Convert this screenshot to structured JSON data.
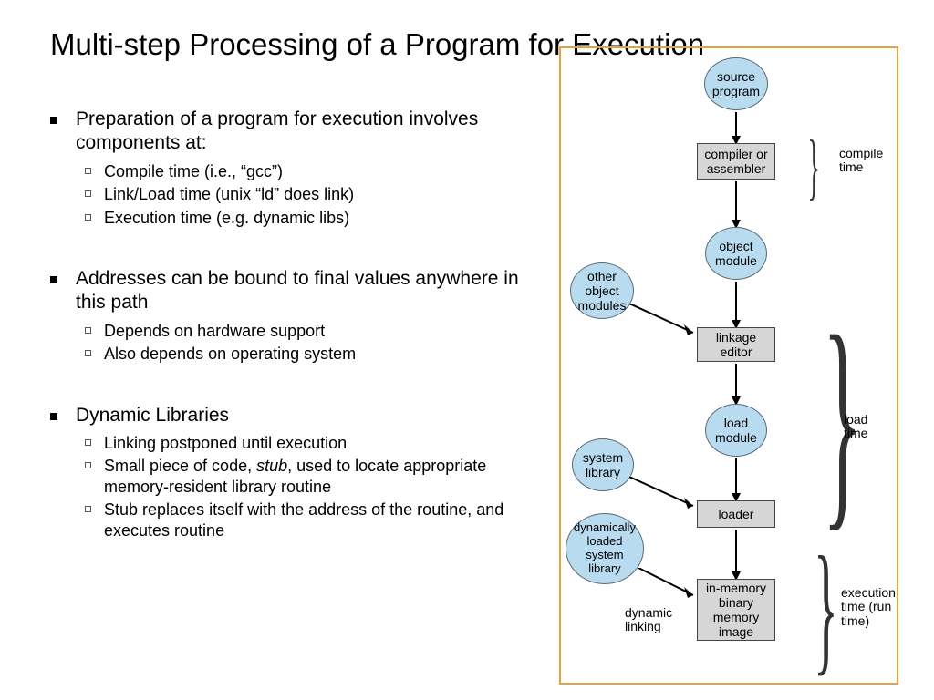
{
  "title": "Multi-step Processing of a Program for Execution",
  "bullets": {
    "g1": {
      "head": "Preparation of a program for execution involves components at:",
      "sub": [
        "Compile time (i.e., “gcc”)",
        "Link/Load time (unix “ld” does link)",
        "Execution time (e.g. dynamic libs)"
      ]
    },
    "g2": {
      "head": "Addresses can be bound to final values anywhere in this path",
      "sub": [
        "Depends on hardware support",
        "Also depends on operating system"
      ]
    },
    "g3": {
      "head": "Dynamic Libraries",
      "sub": [
        "Linking postponed until execution",
        "Small piece of code, stub, used to locate appropriate memory-resident library routine",
        "Stub replaces itself with the address of the routine, and executes routine"
      ]
    }
  },
  "diagram": {
    "nodes": {
      "source": "source\nprogram",
      "compiler": "compiler or\nassembler",
      "object": "object\nmodule",
      "other_obj": "other\nobject\nmodules",
      "linkage": "linkage\neditor",
      "loadmod": "load\nmodule",
      "syslib": "system\nlibrary",
      "loader": "loader",
      "dynlib": "dynamically\nloaded\nsystem\nlibrary",
      "inmem": "in-memory\nbinary\nmemory\nimage"
    },
    "phases": {
      "compile": "compile\ntime",
      "load": "load\ntime",
      "exec": "execution\ntime (run\ntime)"
    },
    "caption": "dynamic\nlinking"
  }
}
